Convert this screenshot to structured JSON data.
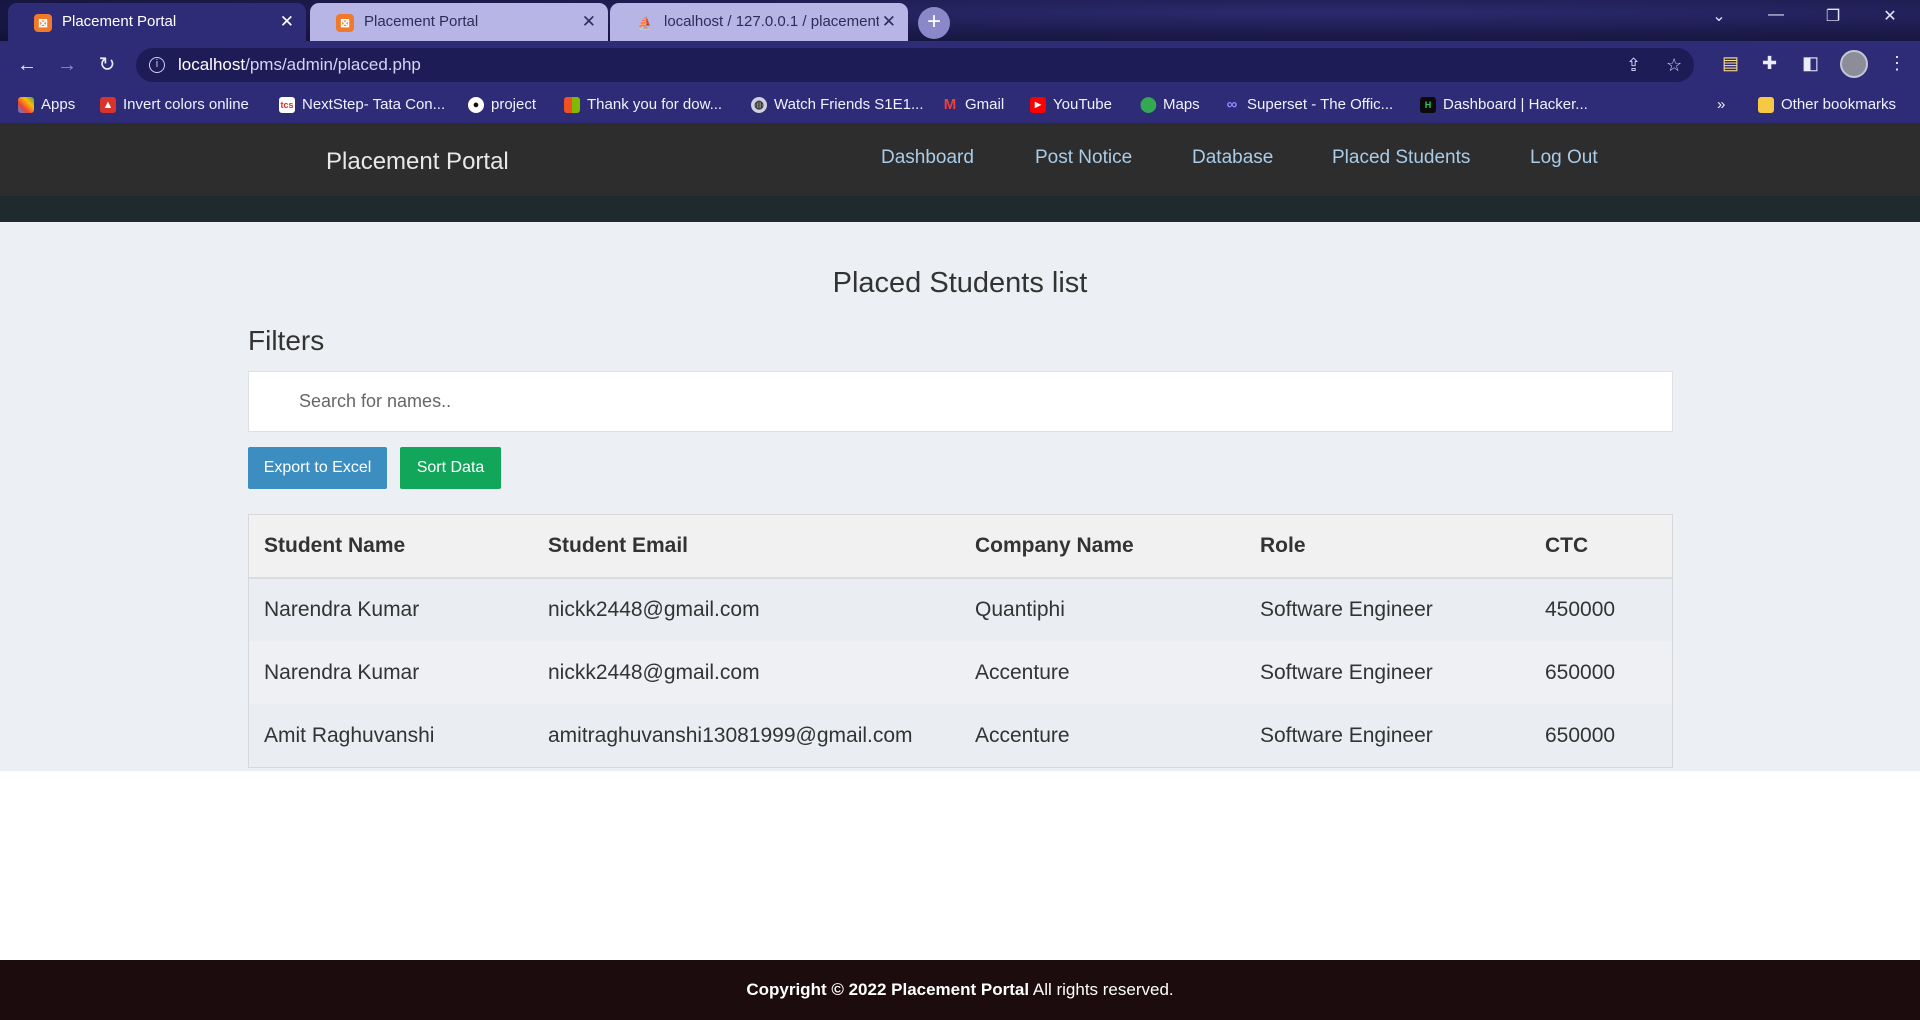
{
  "browser": {
    "tabs": [
      {
        "title": "Placement Portal",
        "active": true
      },
      {
        "title": "Placement Portal",
        "active": false
      },
      {
        "title": "localhost / 127.0.0.1 / placement",
        "active": false
      }
    ],
    "url_host": "localhost",
    "url_path": "/pms/admin/placed.php",
    "bookmarks": [
      {
        "label": "Apps",
        "icon": "apps-grid-icon"
      },
      {
        "label": "Invert colors online",
        "icon": "tree-icon"
      },
      {
        "label": "NextStep- Tata Con...",
        "icon": "tcs-icon"
      },
      {
        "label": "project",
        "icon": "github-icon"
      },
      {
        "label": "Thank you for dow...",
        "icon": "microsoft-icon"
      },
      {
        "label": "Watch Friends S1E1...",
        "icon": "globe-icon"
      },
      {
        "label": "Gmail",
        "icon": "gmail-icon"
      },
      {
        "label": "YouTube",
        "icon": "youtube-icon"
      },
      {
        "label": "Maps",
        "icon": "maps-icon"
      },
      {
        "label": "Superset - The Offic...",
        "icon": "superset-icon"
      },
      {
        "label": "Dashboard | Hacker...",
        "icon": "hackerrank-icon"
      }
    ],
    "other_bookmarks": "Other bookmarks",
    "more_bookmarks": "»"
  },
  "site": {
    "brand": "Placement Portal",
    "nav": [
      "Dashboard",
      "Post Notice",
      "Database",
      "Placed Students",
      "Log Out"
    ]
  },
  "page": {
    "title": "Placed Students list",
    "filters_title": "Filters",
    "search_placeholder": "Search for names..",
    "export_label": "Export to Excel",
    "sort_label": "Sort Data"
  },
  "table": {
    "headers": [
      "Student Name",
      "Student Email",
      "Company Name",
      "Role",
      "CTC"
    ],
    "rows": [
      [
        "Narendra Kumar",
        "nickk2448@gmail.com",
        "Quantiphi",
        "Software Engineer",
        "450000"
      ],
      [
        "Narendra Kumar",
        "nickk2448@gmail.com",
        "Accenture",
        "Software Engineer",
        "650000"
      ],
      [
        "Amit Raghuvanshi",
        "amitraghuvanshi13081999@gmail.com",
        "Accenture",
        "Software Engineer",
        "650000"
      ]
    ]
  },
  "footer": {
    "bold": "Copyright © 2022 Placement Portal",
    "rest": " All rights reserved."
  },
  "colors": {
    "navbar": "#2d2d2d",
    "nav_link": "#a9cce8",
    "export_button": "#3d8ec0",
    "sort_button": "#12a65a",
    "footer": "#1c0c0e"
  }
}
